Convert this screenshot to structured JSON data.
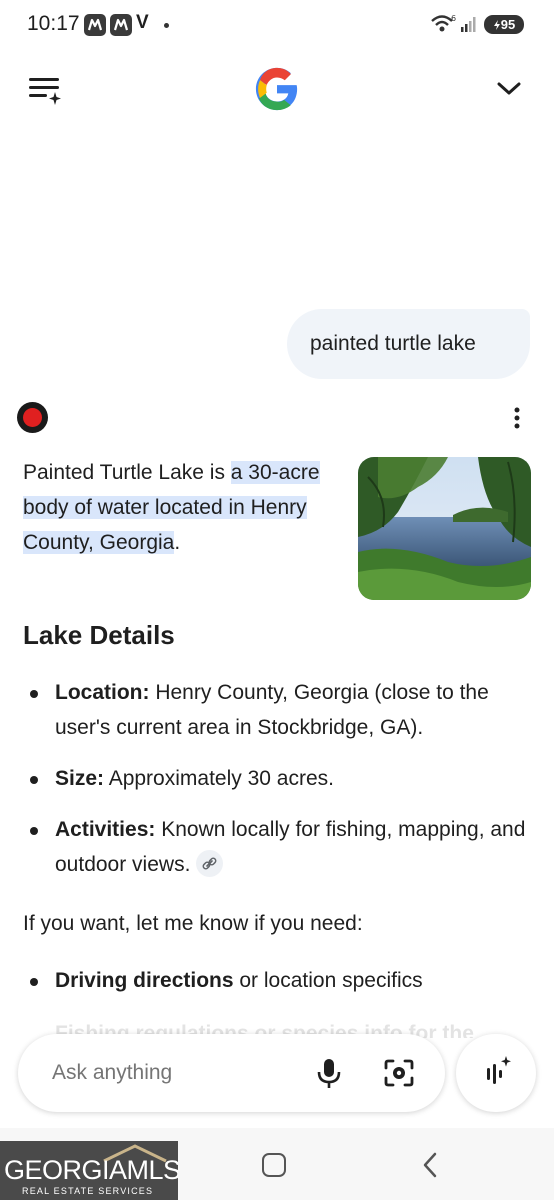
{
  "status_bar": {
    "time": "10:17",
    "notif_letter": "V",
    "battery": "95"
  },
  "header": {
    "logo_icon": "google-g-icon",
    "menu_icon": "menu-sparkle-icon",
    "chevron_icon": "chevron-down-icon"
  },
  "conversation": {
    "user_query": "painted turtle lake",
    "intro_plain": "Painted Turtle Lake is ",
    "intro_highlight": "a 30-acre body of water located in Henry County, Georgia",
    "intro_end": ".",
    "section_title": "Lake Details",
    "details": [
      {
        "label": "Location:",
        "text": " Henry County, Georgia (close to the user's current area in Stockbridge, GA)."
      },
      {
        "label": "Size:",
        "text": " Approximately 30 acres."
      },
      {
        "label": "Activities:",
        "text": " Known locally for fishing, mapping, and outdoor views."
      }
    ],
    "followup": "If you want, let me know if you need:",
    "needs": [
      {
        "label": "Driving directions",
        "text": " or location specifics"
      }
    ],
    "faded_text": "Fishing regulations or species info for the"
  },
  "input_bar": {
    "placeholder": "Ask anything"
  },
  "watermark": {
    "brand": "GEORGIAMLS",
    "sub": "REAL ESTATE SERVICES"
  },
  "colors": {
    "highlight": "#d9e6fb",
    "bubble": "#f0f4f9",
    "text": "#1f1f1f"
  }
}
